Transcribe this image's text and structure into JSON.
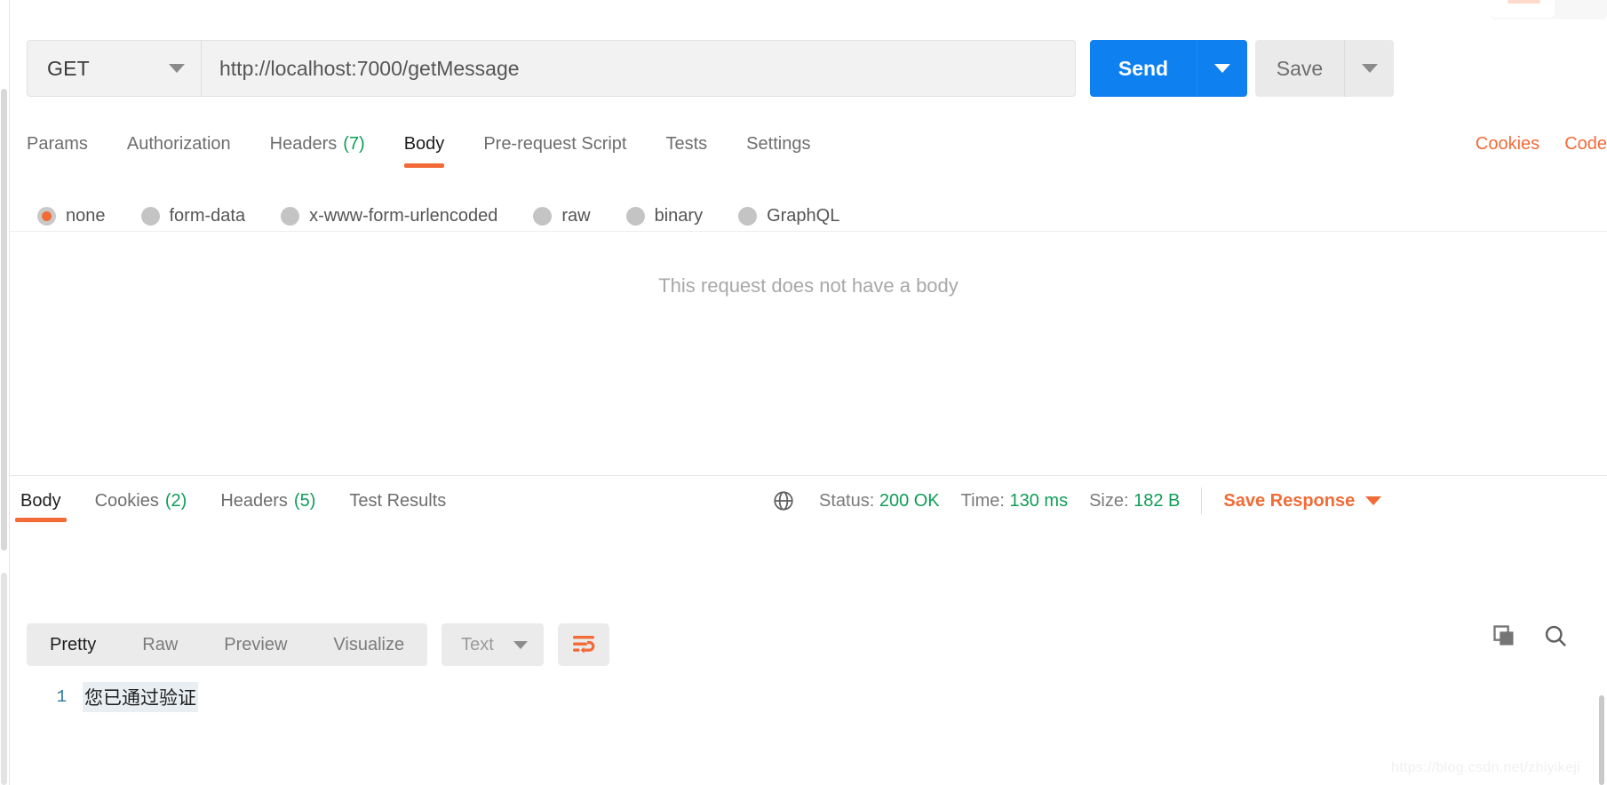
{
  "request": {
    "method": "GET",
    "url": "http://localhost:7000/getMessage",
    "send_label": "Send",
    "save_label": "Save",
    "tabs": [
      {
        "label": "Params",
        "count": "",
        "active": false
      },
      {
        "label": "Authorization",
        "count": "",
        "active": false
      },
      {
        "label": "Headers",
        "count": "(7)",
        "active": false
      },
      {
        "label": "Body",
        "count": "",
        "active": true
      },
      {
        "label": "Pre-request Script",
        "count": "",
        "active": false
      },
      {
        "label": "Tests",
        "count": "",
        "active": false
      },
      {
        "label": "Settings",
        "count": "",
        "active": false
      }
    ],
    "right_links": [
      {
        "label": "Cookies"
      },
      {
        "label": "Code"
      }
    ],
    "body_types": [
      {
        "label": "none",
        "selected": true
      },
      {
        "label": "form-data",
        "selected": false
      },
      {
        "label": "x-www-form-urlencoded",
        "selected": false
      },
      {
        "label": "raw",
        "selected": false
      },
      {
        "label": "binary",
        "selected": false
      },
      {
        "label": "GraphQL",
        "selected": false
      }
    ],
    "empty_body_message": "This request does not have a body"
  },
  "response": {
    "tabs": [
      {
        "label": "Body",
        "count": "",
        "active": true
      },
      {
        "label": "Cookies",
        "count": "(2)",
        "active": false
      },
      {
        "label": "Headers",
        "count": "(5)",
        "active": false
      },
      {
        "label": "Test Results",
        "count": "",
        "active": false
      }
    ],
    "status_label": "Status:",
    "status_value": "200 OK",
    "time_label": "Time:",
    "time_value": "130 ms",
    "size_label": "Size:",
    "size_value": "182 B",
    "save_response_label": "Save Response",
    "view_modes": [
      {
        "label": "Pretty",
        "active": true
      },
      {
        "label": "Raw",
        "active": false
      },
      {
        "label": "Preview",
        "active": false
      },
      {
        "label": "Visualize",
        "active": false
      }
    ],
    "format_selected": "Text",
    "body_lines": [
      {
        "number": "1",
        "text": "您已通过验证"
      }
    ]
  },
  "icons": {
    "globe": "globe-icon",
    "copy": "copy-icon",
    "search": "search-icon",
    "wrap": "word-wrap-icon"
  },
  "colors": {
    "accent_orange": "#f26b37",
    "send_blue": "#0f80f0",
    "status_green": "#0f9d58"
  },
  "watermark": "https://blog.csdn.net/zhiyikeji"
}
